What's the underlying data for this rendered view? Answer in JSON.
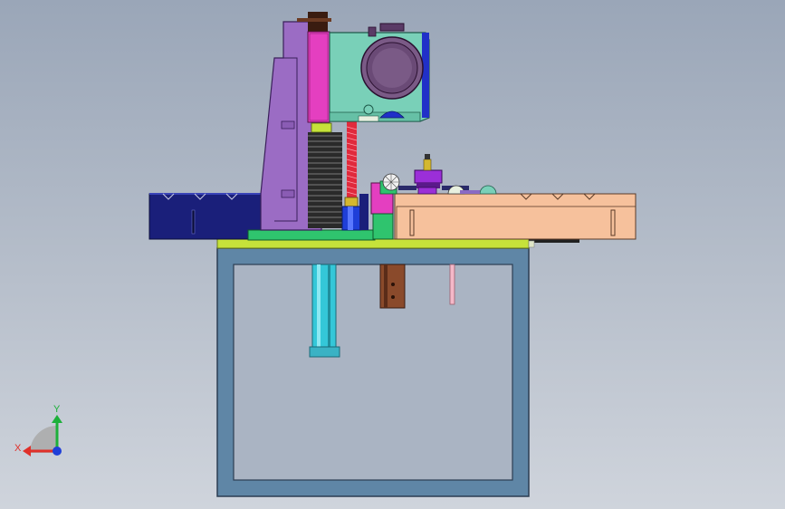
{
  "viewport": {
    "background_top": "#9aa6b8",
    "background_bottom": "#cfd4dc"
  },
  "triad": {
    "x_label": "X",
    "y_label": "Y",
    "x_color": "#e0302a",
    "y_color": "#1db03a",
    "z_color": "#1f3fd8"
  },
  "colors": {
    "frame": "#5f86a6",
    "frame_edge": "#2c3d52",
    "table_top": "#c6e23a",
    "left_rail": "#1a1f7a",
    "right_rail": "#f6c19c",
    "column": "#9b6cc4",
    "slide": "#e43fc0",
    "head_body": "#79d0b8",
    "motor": "#7a5a86",
    "cylinder": "#34c7d8",
    "base_plate": "#2fc46e"
  }
}
